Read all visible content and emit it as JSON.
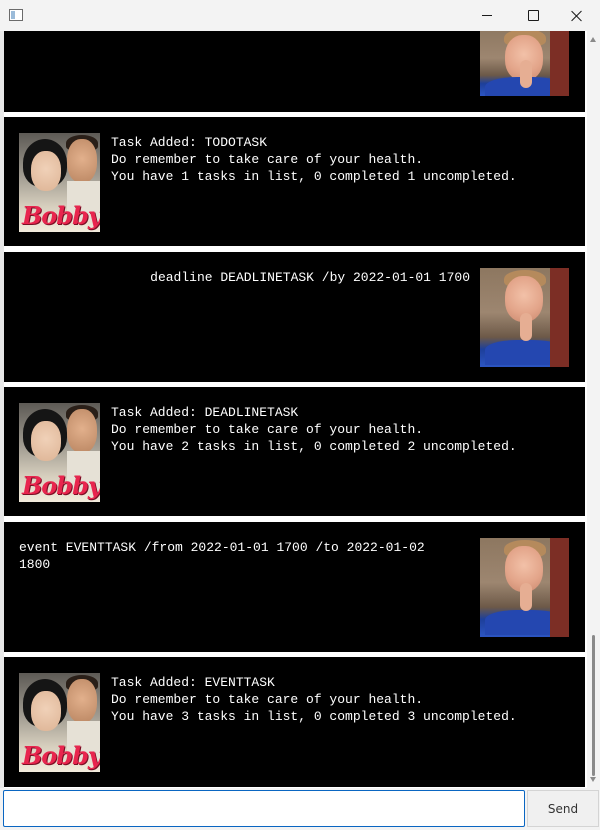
{
  "window": {
    "icon": "app-window-icon",
    "controls": [
      "minimize-icon",
      "maximize-icon",
      "close-icon"
    ]
  },
  "chat": {
    "messages": [
      {
        "sender": "user",
        "text": "",
        "avatar": "user-avatar"
      },
      {
        "sender": "bot",
        "text": "Task Added: TODOTASK\nDo remember to take care of your health.\nYou have 1 tasks in list, 0 completed 1 uncompleted.",
        "avatar": "bot-avatar"
      },
      {
        "sender": "user",
        "text": "deadline DEADLINETASK /by 2022-01-01 1700",
        "avatar": "user-avatar"
      },
      {
        "sender": "bot",
        "text": "Task Added: DEADLINETASK\nDo remember to take care of your health.\nYou have 2 tasks in list, 0 completed 2 uncompleted.",
        "avatar": "bot-avatar"
      },
      {
        "sender": "user",
        "text": "event EVENTTASK /from 2022-01-01 1700 /to 2022-01-02\n1800",
        "avatar": "user-avatar"
      },
      {
        "sender": "bot",
        "text": "Task Added: EVENTTASK\nDo remember to take care of your health.\nYou have 3 tasks in list, 0 completed 3 uncompleted.",
        "avatar": "bot-avatar"
      }
    ],
    "bot_avatar_logo": "Bobby"
  },
  "input": {
    "value": "",
    "placeholder": ""
  },
  "send_label": "Send",
  "colors": {
    "bubble_background": "#000000",
    "bubble_text": "#ffffff",
    "input_border": "#0a66c2",
    "bot_logo": "#e8254e"
  }
}
